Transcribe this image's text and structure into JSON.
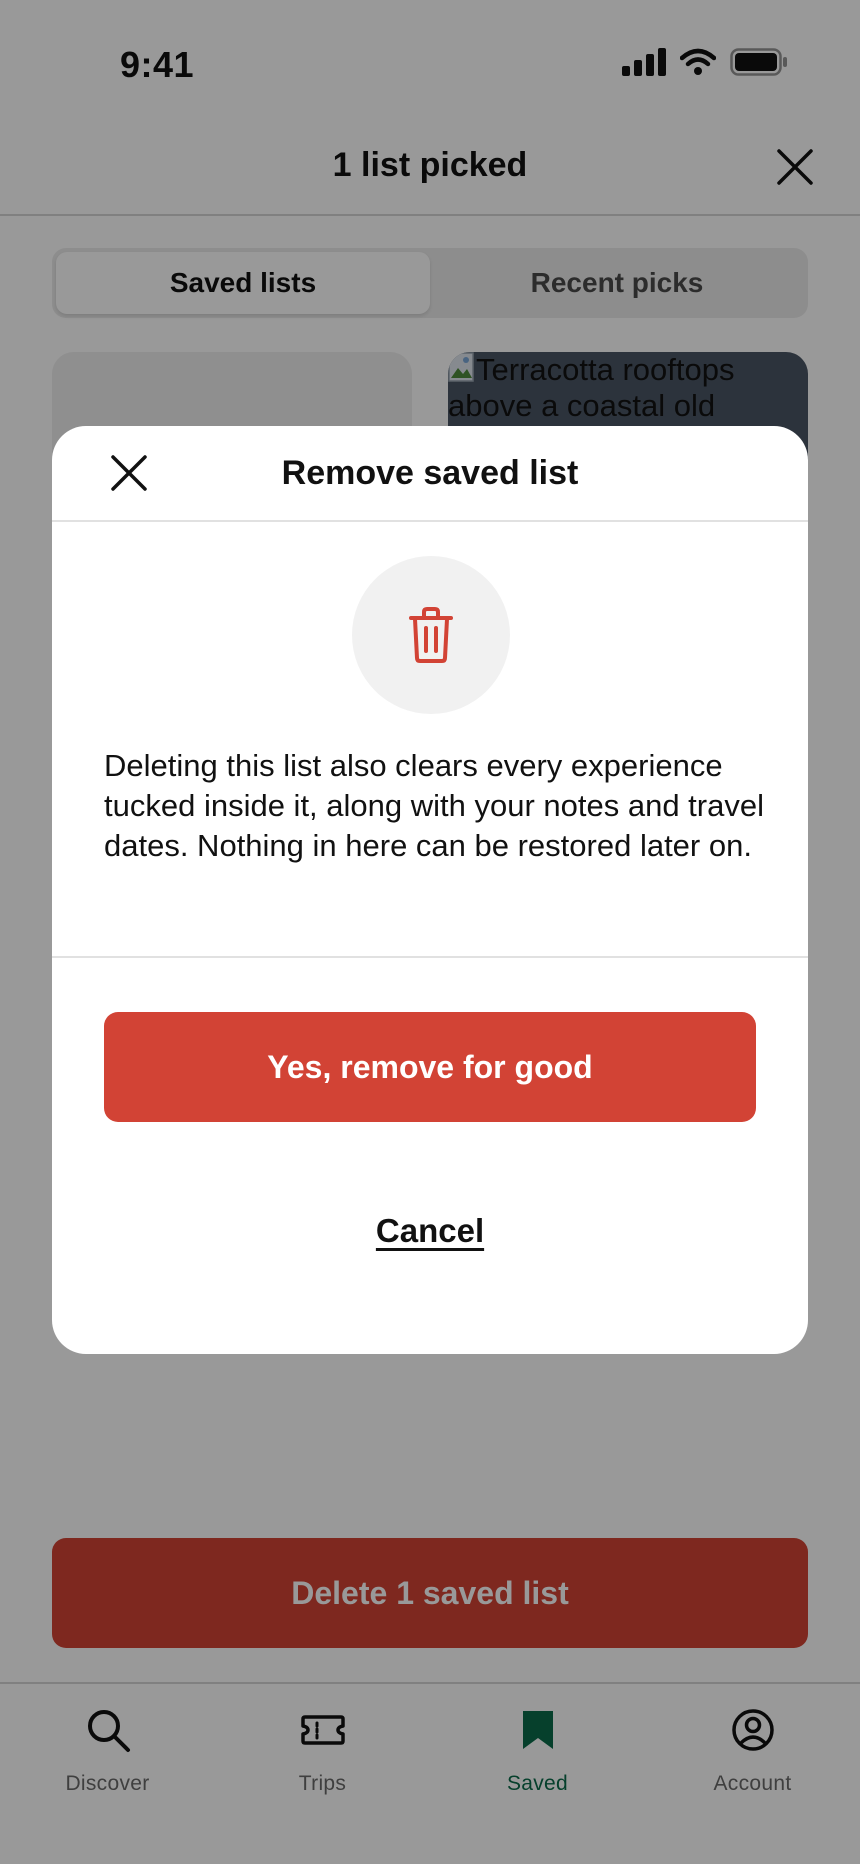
{
  "status_bar": {
    "time": "9:41",
    "icons": [
      "signal-icon",
      "wifi-icon",
      "battery-icon"
    ]
  },
  "header": {
    "title": "1 list picked",
    "close_icon": "close-icon"
  },
  "tabs": {
    "items": [
      {
        "label": "Saved lists",
        "active": true
      },
      {
        "label": "Recent picks",
        "active": false
      }
    ]
  },
  "cards": {
    "right_image_alt": "Terracotta rooftops above a coastal old"
  },
  "delete_bar": {
    "label": "Delete 1 saved list"
  },
  "bottom_nav": {
    "items": [
      {
        "label": "Discover",
        "icon": "search-icon",
        "active": false
      },
      {
        "label": "Trips",
        "icon": "ticket-icon",
        "active": false
      },
      {
        "label": "Saved",
        "icon": "bookmark-icon",
        "active": true
      },
      {
        "label": "Account",
        "icon": "account-icon",
        "active": false
      }
    ]
  },
  "modal": {
    "title": "Remove saved list",
    "icon": "trash-icon",
    "body": "Deleting this list also clears every experience tucked inside it, along with your notes and travel dates. Nothing in here can be restored later on.",
    "confirm_label": "Yes, remove for good",
    "cancel_label": "Cancel"
  },
  "colors": {
    "danger": "#d24335",
    "active_tab": "#0b6b4a",
    "scrim": "rgba(0,0,0,0.40)"
  }
}
